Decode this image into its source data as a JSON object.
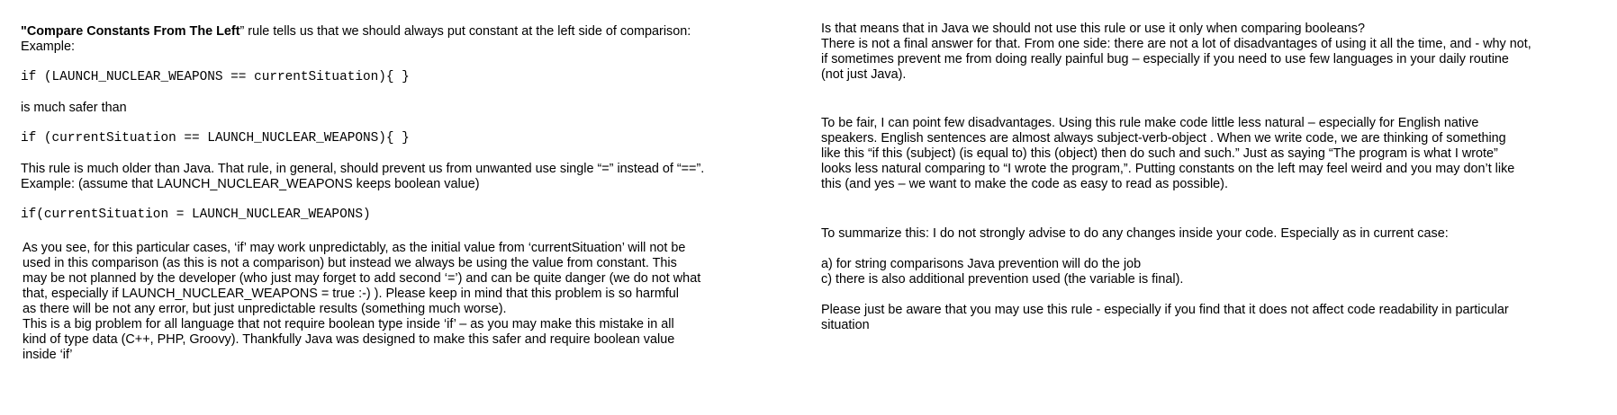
{
  "left": {
    "intro_q_open": "\"",
    "intro_rule_name": "Compare Constants From The Left",
    "intro_rest": "” rule tells us that we should always put constant at the left side of comparison:",
    "example_label_1": "Example:",
    "code_1": "if (LAUNCH_NUCLEAR_WEAPONS == currentSituation){ }",
    "safer_text": "is much safer than",
    "code_2": "if (currentSituation == LAUNCH_NUCLEAR_WEAPONS){ }",
    "older_line": "This rule is much older than Java.  That rule, in general, should prevent us from unwanted use single “=” instead of “==”.",
    "example_label_2": "Example: (assume that LAUNCH_NUCLEAR_WEAPONS keeps boolean value)",
    "code_3": "if(currentSituation = LAUNCH_NUCLEAR_WEAPONS)",
    "para_lines": [
      "As you see, for this particular cases, ‘if’ may work unpredictably, as the initial value from ‘currentSituation’  will not be",
      "used in this comparison (as this is not a comparison) but instead we always be using the value from constant.  This",
      "may be not planned by the developer (who just may forget to add second ‘=’) and can be quite danger (we do not what",
      "that, especially if  LAUNCH_NUCLEAR_WEAPONS = true :-) ). Please keep in mind that this problem is so harmful",
      "as there will be not any error, but just unpredictable results (something much worse).",
      "This is a big problem for all language that not require boolean type inside ‘if’ – as you may make this mistake in all",
      "kind of type data (C++, PHP, Groovy). Thankfully Java was designed to make this safer and require boolean value",
      "inside ‘if’"
    ]
  },
  "right": {
    "p1_lines": [
      "Is that means that in Java we should not use this rule or use it only when comparing booleans?",
      "There is not a final answer for that. From one side: there are not a lot of disadvantages of using it all the time, and -  why not,",
      "if sometimes prevent me from doing really painful bug – especially if you need to use few languages in your daily routine",
      "(not just Java)."
    ],
    "p2_lines": [
      "To be fair, I can point few disadvantages. Using this rule make code little less natural – especially for English native",
      "speakers. English sentences are almost always subject-verb-object .  When we write code, we are thinking of something",
      "like this  “if this (subject) (is equal to) this (object) then do such and such.” Just as saying “The program is what I wrote”",
      "looks less natural comparing to “I wrote the program,”. Putting constants on the left may feel weird and you may don’t like",
      "this (and yes – we want to make the code as easy to read as possible)."
    ],
    "summary": "To summarize this: I do not strongly advise to do any changes inside your code. Especially as in current case:",
    "list_a": "a) for string comparisons Java prevention will do the job",
    "list_c": "c) there is also additional prevention used (the variable is final).",
    "closing_lines": [
      "Please just be aware that you may use this rule - especially if you find that it does not affect code readability in particular",
      "situation"
    ]
  }
}
